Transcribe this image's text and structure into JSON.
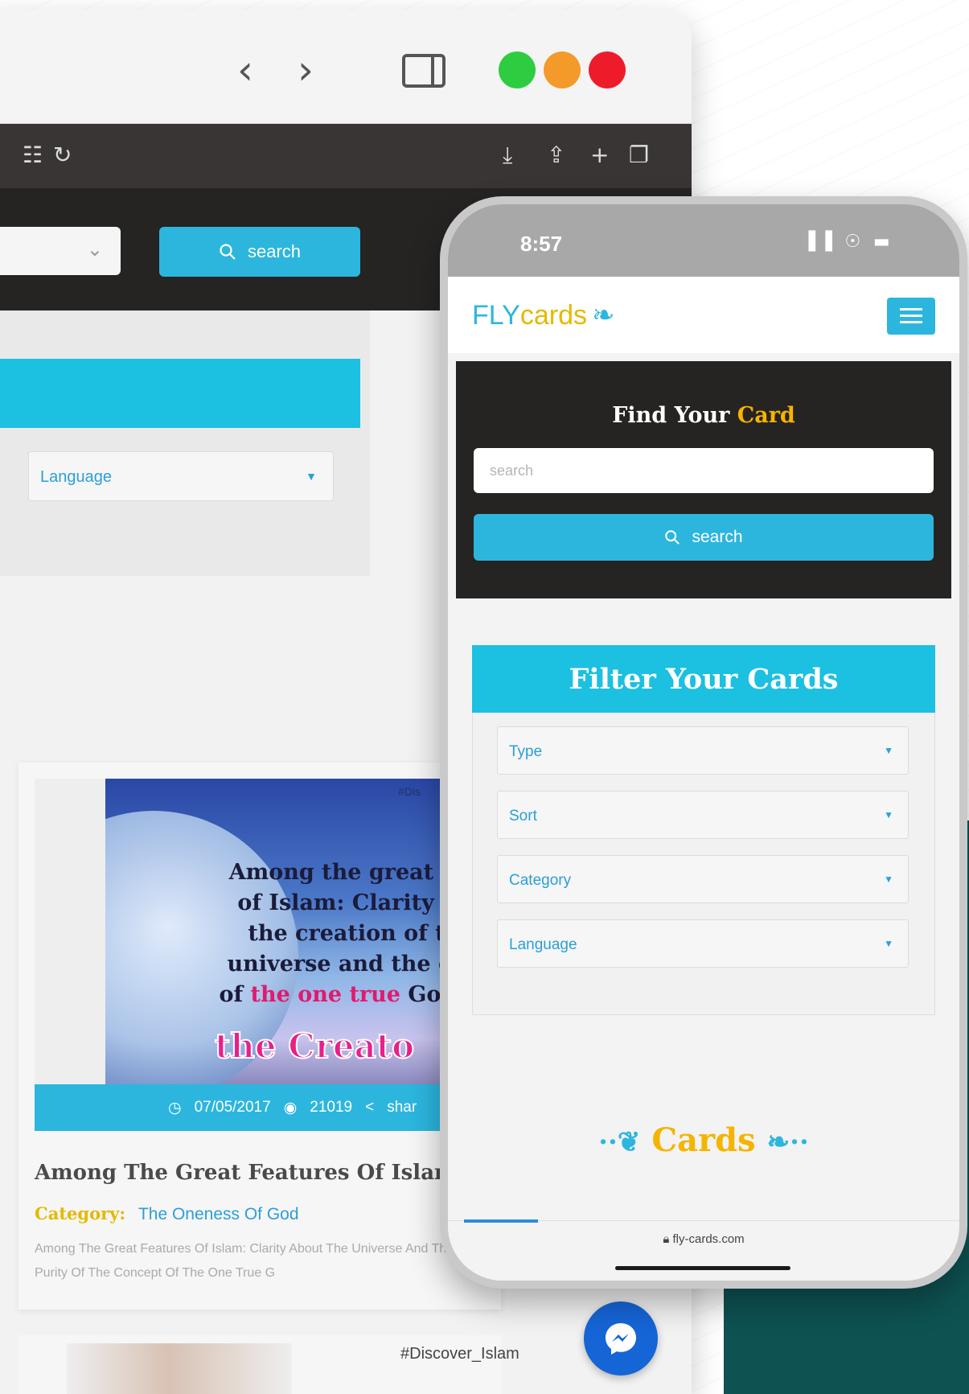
{
  "desktop": {
    "search_button_label": "search",
    "language_label": "Language",
    "card": {
      "image_hashtag": "#Dis",
      "image_quote_lines": [
        "Among the great fe",
        "of Islam: Clarity a",
        "the creation of t",
        "universe and the co"
      ],
      "image_quote_pre": "of ",
      "image_quote_pink": "the one true",
      "image_quote_post": " God (",
      "image_creator": "the Creato",
      "date": "07/05/2017",
      "views": "21019",
      "share_label": "shar",
      "title": "Among The Great Features Of Islam",
      "category_label": "Category:",
      "category_value": "The Oneness Of God",
      "description": "Among The Great Features Of Islam: Clarity About The Universe And The Purity Of The Concept Of The One True G"
    },
    "card2": {
      "tag": "#Discover_Islam"
    }
  },
  "phone": {
    "time": "8:57",
    "logo": {
      "fly": "FLY",
      "cards": "cards"
    },
    "find": {
      "title_pre": "Find Your ",
      "title_accent": "Card",
      "search_placeholder": "search",
      "search_button_label": "search"
    },
    "filter": {
      "title": "Filter Your Cards",
      "selects": [
        "Type",
        "Sort",
        "Category",
        "Language"
      ]
    },
    "cards_heading": "Cards",
    "url": "fly-cards.com"
  },
  "colors": {
    "accent_cyan": "#2cb6de",
    "filter_cyan": "#1cc0e0",
    "accent_yellow": "#f5b400",
    "dark_panel": "#262323",
    "teal_bg": "#0e5252"
  },
  "icons": [
    "back-icon",
    "forward-icon",
    "sidebar-icon",
    "translate-icon",
    "reload-icon",
    "download-icon",
    "share-icon",
    "new-tab-icon",
    "tabs-icon",
    "search-icon",
    "clock-icon",
    "eye-icon",
    "share-icon",
    "messenger-icon",
    "signal-icon",
    "wifi-icon",
    "battery-icon",
    "bird-logo-icon",
    "menu-icon",
    "lock-icon"
  ]
}
